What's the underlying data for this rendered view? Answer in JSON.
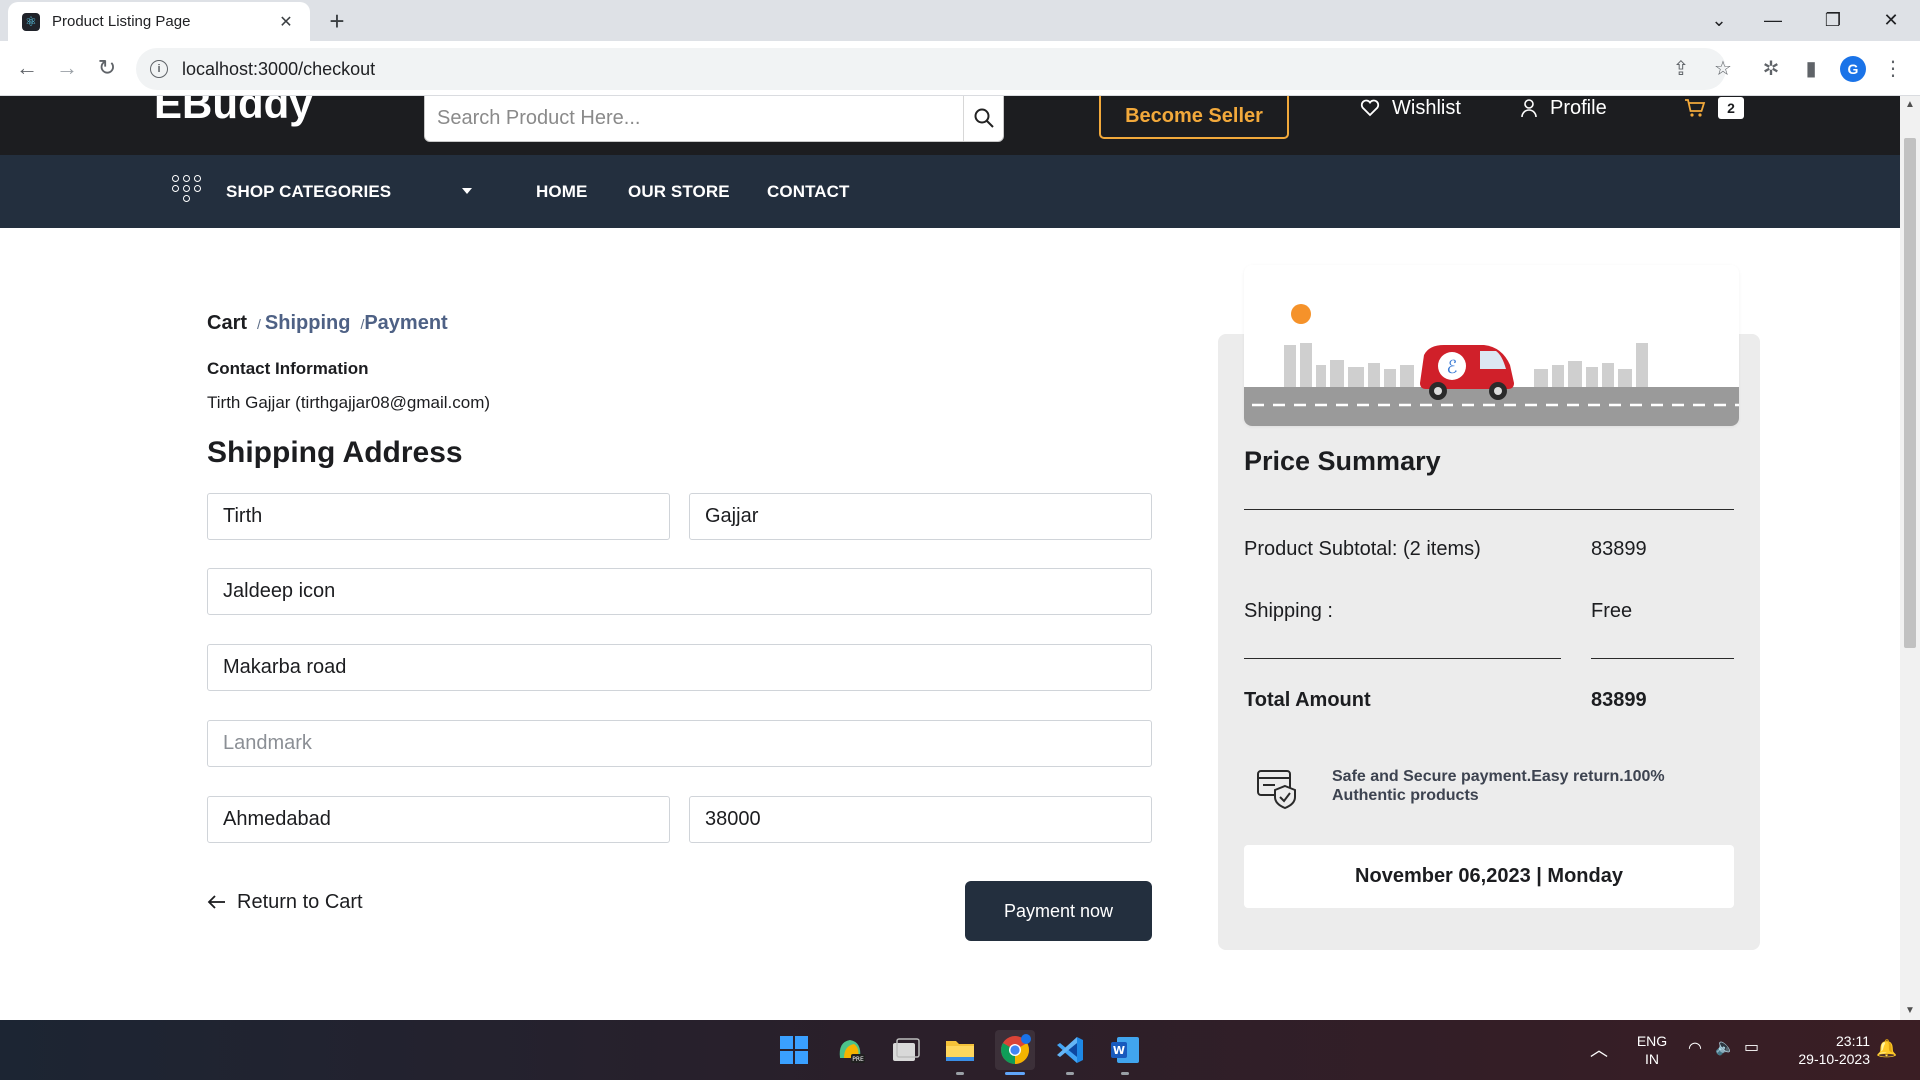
{
  "browser": {
    "tab_title": "Product Listing Page",
    "url": "localhost:3000/checkout",
    "profile_initial": "G"
  },
  "site": {
    "logo": "EBuddy",
    "search_placeholder": "Search Product Here...",
    "become_seller": "Become Seller",
    "wishlist": "Wishlist",
    "profile": "Profile",
    "cart_count": "2",
    "nav": {
      "categories": "SHOP CATEGORIES",
      "home": "HOME",
      "store": "OUR STORE",
      "contact": "CONTACT"
    }
  },
  "checkout": {
    "breadcrumb": {
      "cart": "Cart",
      "sep": "/",
      "shipping": "Shipping",
      "payment": "Payment"
    },
    "contact_title": "Contact Information",
    "contact_value": "Tirth Gajjar (tirthgajjar08@gmail.com)",
    "shipping_title": "Shipping Address",
    "fields": {
      "first_name": "Tirth",
      "last_name": "Gajjar",
      "address1": "Jaldeep icon",
      "address2": "Makarba road",
      "landmark_placeholder": "Landmark",
      "city": "Ahmedabad",
      "pincode": "38000"
    },
    "return_label": "Return to Cart",
    "pay_label": "Payment now"
  },
  "summary": {
    "title": "Price Summary",
    "subtotal_label": "Product Subtotal: (2 items)",
    "subtotal_value": "83899",
    "shipping_label": "Shipping :",
    "shipping_value": "Free",
    "total_label": "Total Amount",
    "total_value": "83899",
    "secure_text": "Safe and Secure payment.Easy return.100% Authentic products",
    "delivery_date": "November 06,2023 | Monday"
  },
  "taskbar": {
    "lang_line1": "ENG",
    "lang_line2": "IN",
    "time": "23:11",
    "date": "29-10-2023"
  },
  "colors": {
    "header_bg": "#1c1d20",
    "nav_bg": "#232f3e",
    "seller_accent": "#f2a93b",
    "truck_red": "#d0202a"
  }
}
